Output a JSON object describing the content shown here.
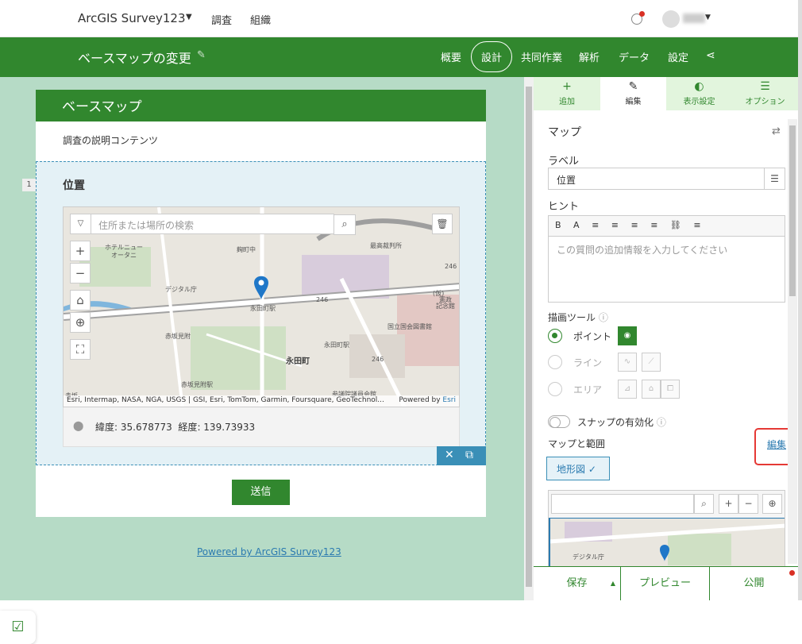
{
  "topbar": {
    "brand": "ArcGIS Survey123",
    "nav": [
      "調査",
      "組織"
    ]
  },
  "header": {
    "title": "ベースマップの変更",
    "nav": [
      "概要",
      "設計",
      "共同作業",
      "解析",
      "データ",
      "設定"
    ],
    "active_nav": "設計"
  },
  "form": {
    "header": "ベースマップ",
    "description": "調査の説明コンテンツ",
    "question_number": "1",
    "question_label": "位置",
    "map": {
      "search_placeholder": "住所または場所の検索",
      "attribution": "Esri, Intermap, NASA, NGA, USGS | GSI, Esri, TomTom, Garmin, Foursquare, GeoTechnol...",
      "powered_by_prefix": "Powered by ",
      "powered_by_brand": "Esri",
      "labels": [
        "ホテルニュー",
        "オータニ",
        "麹町中",
        "最高裁判所",
        "デジタル庁",
        "永田町駅",
        "(仮)",
        "憲政",
        "記念館",
        "赤坂見附",
        "国立国会図書館",
        "永田町駅",
        "永田町",
        "赤坂",
        "赤坂見附駅",
        "参議院議員会館",
        "246",
        "246",
        "246"
      ]
    },
    "coords_label_lat": "緯度",
    "lat": "35.678773",
    "coords_label_lon": "経度",
    "lon": "139.73933",
    "submit": "送信"
  },
  "powered_by": "Powered by ArcGIS Survey123",
  "panel": {
    "tabs": [
      "追加",
      "編集",
      "表示設定",
      "オプション"
    ],
    "active_tab": "編集",
    "section_title": "マップ",
    "label_heading": "ラベル",
    "label_value": "位置",
    "hint_heading": "ヒント",
    "hint_toolbar": "B A  ≡ ≡ ≡ ≡  ⛓ ≡",
    "hint_placeholder": "この質問の追加情報を入力してください",
    "draw_tools_heading": "描画ツール",
    "draw_options": [
      "ポイント",
      "ライン",
      "エリア"
    ],
    "snap_label": "スナップの有効化",
    "map_extent_heading": "マップと範囲",
    "edit_link": "編集",
    "basemap_chip": "地形図 ✓",
    "mini_map_label": "デジタル庁"
  },
  "footer": {
    "save": "保存",
    "preview": "プレビュー",
    "publish": "公開"
  },
  "colors": {
    "brand_green": "#31872e",
    "accent_blue": "#3a8fb7",
    "highlight_red": "#e53935"
  }
}
